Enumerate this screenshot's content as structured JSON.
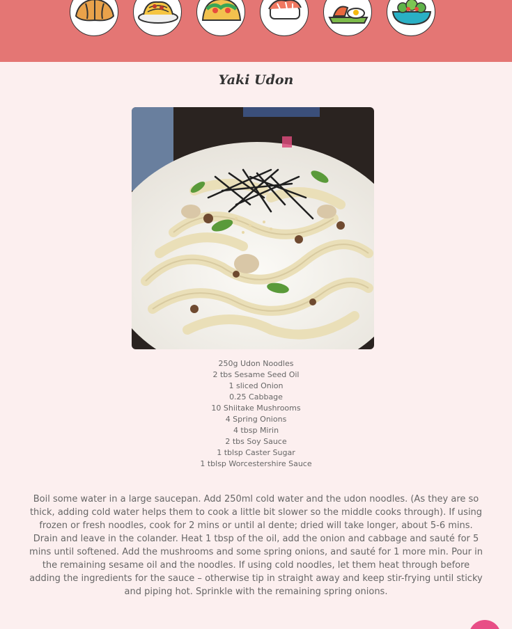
{
  "header": {
    "categories": [
      {
        "icon": "croissant-icon"
      },
      {
        "icon": "spaghetti-icon"
      },
      {
        "icon": "taco-icon"
      },
      {
        "icon": "sushi-icon"
      },
      {
        "icon": "breakfast-icon"
      },
      {
        "icon": "salad-bowl-icon"
      }
    ]
  },
  "recipe": {
    "title": "Yaki Udon",
    "ingredients": [
      "250g Udon Noodles",
      "2 tbs Sesame Seed Oil",
      "1 sliced Onion",
      "0.25 Cabbage",
      "10 Shiitake Mushrooms",
      "4 Spring Onions",
      "4 tbsp Mirin",
      "2 tbs Soy Sauce",
      "1 tblsp Caster Sugar",
      "1 tblsp Worcestershire Sauce"
    ],
    "method": "Boil some water in a large saucepan. Add 250ml cold water and the udon noodles. (As they are so thick, adding cold water helps them to cook a little bit slower so the middle cooks through). If using frozen or fresh noodles, cook for 2 mins or until al dente; dried will take longer, about 5-6 mins. Drain and leave in the colander. Heat 1 tbsp of the oil, add the onion and cabbage and sauté for 5 mins until softened. Add the mushrooms and some spring onions, and sauté for 1 more min. Pour in the remaining sesame oil and the noodles. If using cold noodles, let them heat through before adding the ingredients for the sauce – otherwise tip in straight away and keep stir-frying until sticky and piping hot. Sprinkle with the remaining spring onions."
  },
  "colors": {
    "header": "#e47674",
    "background": "#fcefef",
    "fab": "#e84e86"
  }
}
